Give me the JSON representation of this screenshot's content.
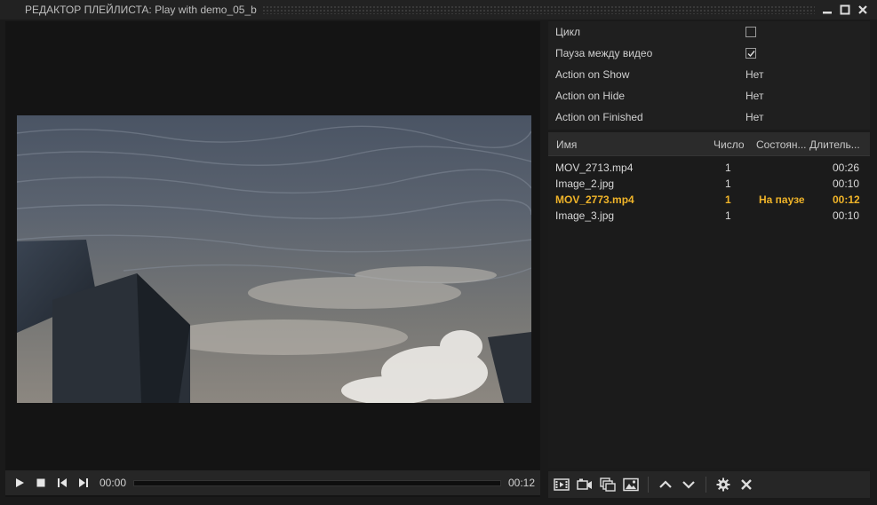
{
  "window": {
    "title": "РЕДАКТОР ПЛЕЙЛИСТА: Play with demo_05_b",
    "buttons": [
      "minimize-icon",
      "maximize-icon",
      "close-icon"
    ]
  },
  "player": {
    "current_time": "00:00",
    "duration": "00:12",
    "progress": 0
  },
  "properties": [
    {
      "label": "Цикл",
      "type": "checkbox",
      "checked": false
    },
    {
      "label": "Пауза между видео",
      "type": "checkbox",
      "checked": true
    },
    {
      "label": "Action on Show",
      "type": "value",
      "value": "Нет"
    },
    {
      "label": "Action on Hide",
      "type": "value",
      "value": "Нет"
    },
    {
      "label": "Action on Finished",
      "type": "value",
      "value": "Нет"
    }
  ],
  "playlist": {
    "columns": {
      "name": "Имя",
      "count": "Число",
      "state": "Состоян...",
      "duration": "Длитель..."
    },
    "rows": [
      {
        "name": "MOV_2713.mp4",
        "count": "1",
        "state": "",
        "duration": "00:26",
        "active": false
      },
      {
        "name": "Image_2.jpg",
        "count": "1",
        "state": "",
        "duration": "00:10",
        "active": false
      },
      {
        "name": "MOV_2773.mp4",
        "count": "1",
        "state": "На паузе",
        "duration": "00:12",
        "active": true
      },
      {
        "name": "Image_3.jpg",
        "count": "1",
        "state": "",
        "duration": "00:10",
        "active": false
      }
    ]
  },
  "toolbar": {
    "icons": [
      "add-video-icon",
      "add-camera-icon",
      "add-copy-icon",
      "add-image-icon",
      "move-up-icon",
      "move-down-icon",
      "settings-icon",
      "delete-icon"
    ]
  },
  "colors": {
    "accent": "#f0b429",
    "background": "#1a1a1a"
  }
}
